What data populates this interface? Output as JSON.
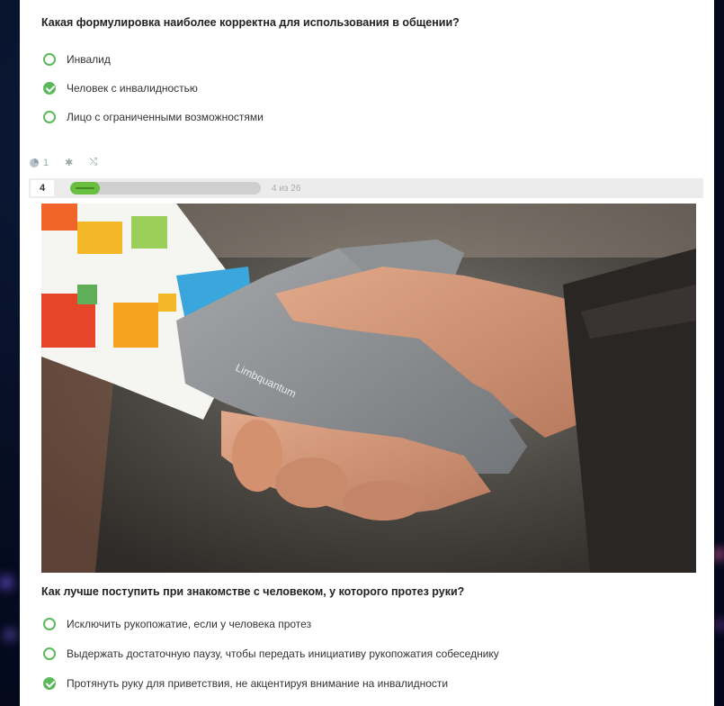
{
  "question1": {
    "title": "Какая формулировка наиболее корректна для использования в общении?",
    "options": [
      {
        "label": "Инвалид",
        "checked": false
      },
      {
        "label": "Человек с инвалидностью",
        "checked": true
      },
      {
        "label": "Лицо с ограниченными возможностями",
        "checked": false
      }
    ]
  },
  "meta": {
    "count": "1",
    "asterisk": "✱",
    "shuffle": "⤭"
  },
  "progress": {
    "number": "4",
    "current": 4,
    "total": 26,
    "text": "4 из 26",
    "fraction": 0.154
  },
  "image": {
    "brand_text": "Limbquantum"
  },
  "question2": {
    "title": "Как лучше поступить при знакомстве с человеком, у которого протез руки?",
    "options": [
      {
        "label": "Исключить рукопожатие, если у человека протез",
        "checked": false
      },
      {
        "label": "Выдержать достаточную паузу, чтобы передать инициативу рукопожатия собеседнику",
        "checked": false
      },
      {
        "label": "Протянуть руку для приветствия, не акцентируя внимание на инвалидности",
        "checked": true
      }
    ]
  },
  "colors": {
    "accent": "#5bb85b",
    "progress_fill": "#6abf40"
  }
}
